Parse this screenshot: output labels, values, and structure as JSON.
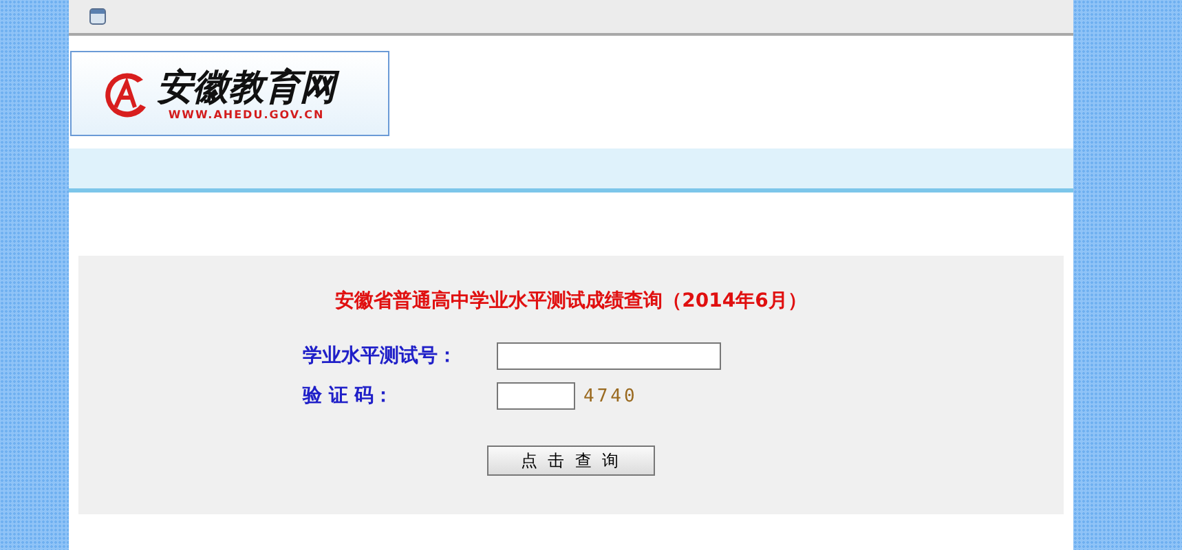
{
  "logo": {
    "name": "安徽教育网",
    "url": "WWW.AHEDU.GOV.CN"
  },
  "form": {
    "title": "安徽省普通高中学业水平测试成绩查询（2014年6月）",
    "fields": [
      {
        "label": "学业水平测试号：",
        "kind": "wide"
      },
      {
        "label": "验 证 码：",
        "kind": "captcha",
        "captcha": "4740"
      }
    ],
    "button": "点 击 查 询"
  }
}
